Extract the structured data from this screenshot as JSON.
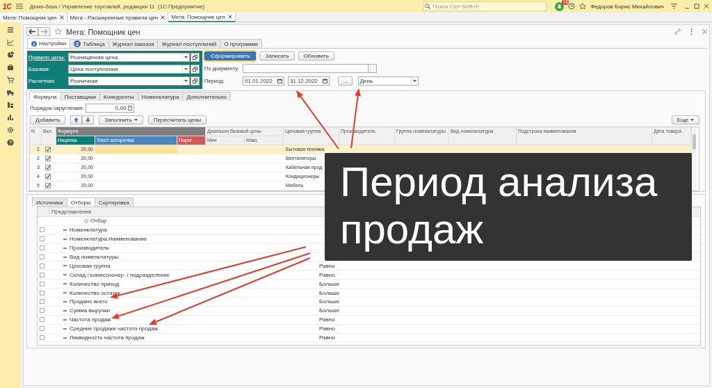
{
  "app_bar": {
    "logo": "1С",
    "title": "Демо-база / Управление торговлей, редакция 11  (1С:Предприятие)",
    "search": {
      "placeholder": "Поиск Ctrl+Shift+F"
    },
    "notifications": "16",
    "user": "Федоров Борис Михайлович"
  },
  "window_tabs": [
    {
      "label": "Мега: Помощник цен",
      "selected": false
    },
    {
      "label": "Мега - Расширенные правила цен",
      "selected": false
    },
    {
      "label": "Мега: Помощник цен",
      "selected": true
    }
  ],
  "form": {
    "title": "Мега: Помощник цен",
    "tabs": [
      {
        "label": "Настройки",
        "kind": "info",
        "selected": true
      },
      {
        "label": "Таблица",
        "kind": "numbered",
        "badge": "2",
        "selected": false
      },
      {
        "label": "Журнал заказов",
        "kind": "plain",
        "selected": false
      },
      {
        "label": "Журнал поступлений",
        "kind": "plain",
        "selected": false
      },
      {
        "label": "О программе",
        "kind": "plain",
        "selected": false
      }
    ],
    "price_settings": [
      {
        "label": "Правило цены:",
        "value": "Розницачная цена",
        "link": true
      },
      {
        "label": "Базовая:",
        "value": "Цена поступления",
        "link": false
      },
      {
        "label": "Расчетная:",
        "value": "Розничная",
        "link": false
      }
    ],
    "actions": [
      {
        "label": "Сформировать",
        "default": true
      },
      {
        "label": "Записать",
        "default": false
      },
      {
        "label": "Обновить",
        "default": false
      }
    ],
    "document": {
      "label": "По документу:"
    },
    "period": {
      "label": "Период:",
      "from": "01.01.2022",
      "to": "31.12.2022",
      "more": "...",
      "step": "День"
    },
    "subtabs": [
      {
        "label": "Формула",
        "selected": true
      },
      {
        "label": "Поставщики",
        "selected": false
      },
      {
        "label": "Конкуренты",
        "selected": false
      },
      {
        "label": "Номенклатура",
        "selected": false
      },
      {
        "label": "Дополнительно",
        "selected": false
      }
    ],
    "rounding": {
      "label": "Порядок округления:",
      "value": "0,00"
    },
    "toolbar": {
      "add": "Добавить",
      "fill": "Заполнить",
      "recalculate": "Пересчитать цены",
      "more": "Еще"
    },
    "table": {
      "columns": {
        "n": "N",
        "enabled": "Вкл.",
        "formula": "Формула",
        "range": "Диапазон базовой цены",
        "price_group": "Ценовая группа",
        "manufacturer": "Производитель",
        "item_group": "Группа номенклатуры",
        "item_kind": "Вид номенклатуры",
        "name_substring": "Подстрока наименования",
        "item_date": "Дата товара"
      },
      "formula_columns": [
        {
          "label": "Наценка",
          "color": "#0e7f78"
        },
        {
          "label": "Текст алгоритма",
          "color": "#4a86c0"
        },
        {
          "label": "Порог",
          "color": "#d05a5a"
        }
      ],
      "range_columns": [
        "Мин",
        "Макс"
      ],
      "rows": [
        {
          "n": "1",
          "enabled": true,
          "markup": "20,00",
          "price_group": "Бытовая техника",
          "selected": true
        },
        {
          "n": "2",
          "enabled": true,
          "markup": "20,00",
          "price_group": "Вентиляторы",
          "selected": false
        },
        {
          "n": "3",
          "enabled": true,
          "markup": "20,00",
          "price_group": "Кабельная прод",
          "selected": false
        },
        {
          "n": "4",
          "enabled": true,
          "markup": "20,00",
          "price_group": "Кондиционеры",
          "selected": false
        },
        {
          "n": "5",
          "enabled": true,
          "markup": "20,00",
          "price_group": "Мебель",
          "selected": false
        }
      ]
    },
    "lower_tabs": [
      {
        "label": "Источники",
        "selected": false
      },
      {
        "label": "Отборы",
        "selected": true
      },
      {
        "label": "Сортировка",
        "selected": false
      }
    ],
    "filters": {
      "column": "Представление",
      "group": "Отбор",
      "items": [
        {
          "name": "Номенклатура",
          "checked": false
        },
        {
          "name": "Номенклатура.Наименование",
          "checked": false
        },
        {
          "name": "Производитель",
          "checked": false
        },
        {
          "name": "Вид номенклатуры",
          "checked": false
        },
        {
          "name": "Ценовая группа",
          "checked": false,
          "condition": "Равно"
        },
        {
          "name": "Склад / комиссионер  / подразделение",
          "checked": false,
          "condition": "Равно"
        },
        {
          "name": "Количество приход",
          "checked": false,
          "condition": "Больше"
        },
        {
          "name": "Количество остаток",
          "checked": false,
          "condition": "Больше"
        },
        {
          "name": "Продано всего",
          "checked": false,
          "condition": "Больше"
        },
        {
          "name": "Сумма выручки",
          "checked": false,
          "condition": "Больше"
        },
        {
          "name": "Частота продаж",
          "checked": false,
          "condition": "Равно"
        },
        {
          "name": "Средние продажи частота продаж",
          "checked": false,
          "condition": "Равно"
        },
        {
          "name": "Ликвидность частота продаж",
          "checked": false,
          "condition": "Равно"
        }
      ]
    }
  },
  "callout": {
    "text": "Период анализа продаж"
  }
}
